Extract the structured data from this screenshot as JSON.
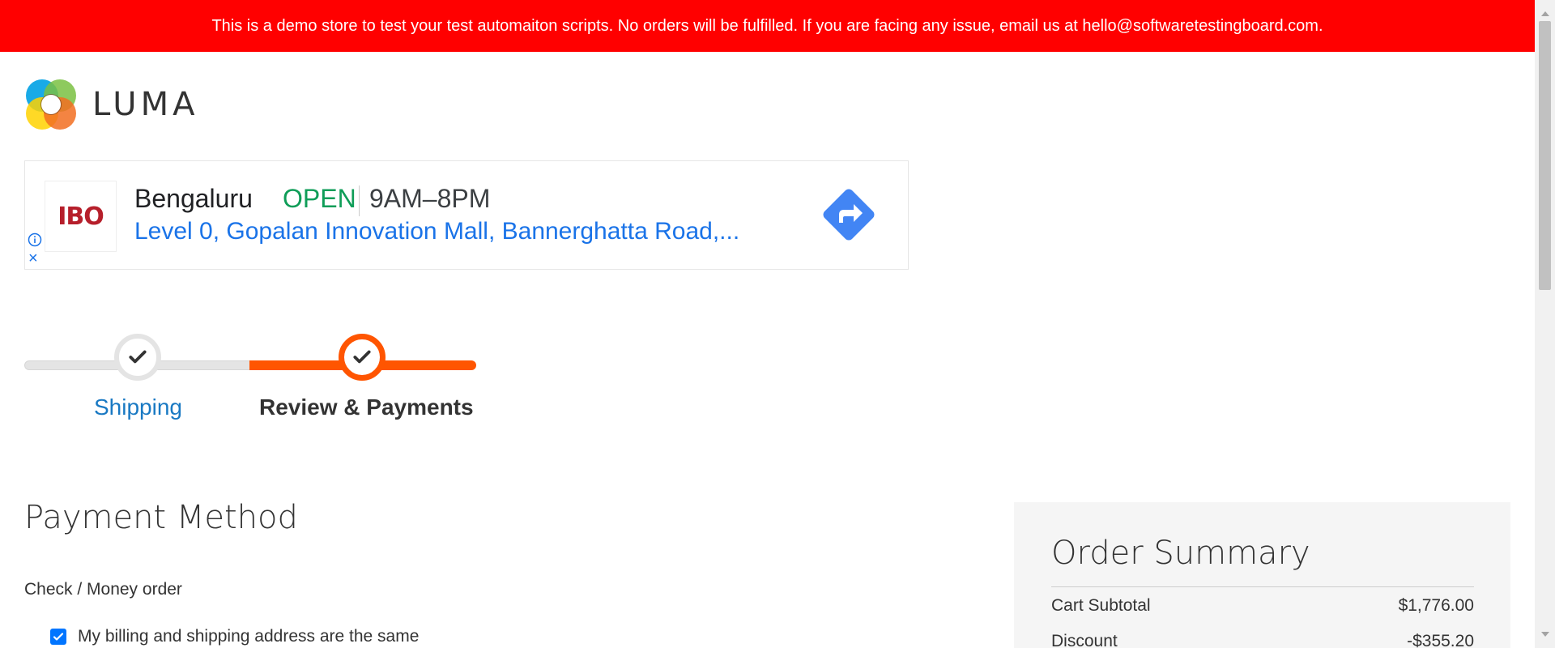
{
  "banner": {
    "text": "This is a demo store to test your test automaiton scripts. No orders will be fulfilled. If you are facing any issue, email us at hello@softwaretestingboard.com."
  },
  "logo": {
    "text": "LUMA"
  },
  "ad": {
    "brand": "IBO",
    "city": "Bengaluru",
    "status": "OPEN",
    "hours": "9AM–8PM",
    "address": "Level 0, Gopalan Innovation Mall, Bannerghatta Road,...",
    "close_icon": "×",
    "colors": {
      "open": "#0f9d58",
      "address": "#1a73e8",
      "directions": "#4285f4"
    }
  },
  "progress": {
    "steps": [
      {
        "label": "Shipping",
        "state": "complete"
      },
      {
        "label": "Review & Payments",
        "state": "active"
      }
    ],
    "accent": "#ff5501"
  },
  "payment": {
    "title": "Payment Method",
    "method": "Check / Money order",
    "billing_same_label": "My billing and shipping address are the same",
    "billing_same_checked": true
  },
  "summary": {
    "title": "Order Summary",
    "rows": [
      {
        "label": "Cart Subtotal",
        "value": "$1,776.00"
      },
      {
        "label": "Discount",
        "value": "-$355.20"
      }
    ]
  }
}
